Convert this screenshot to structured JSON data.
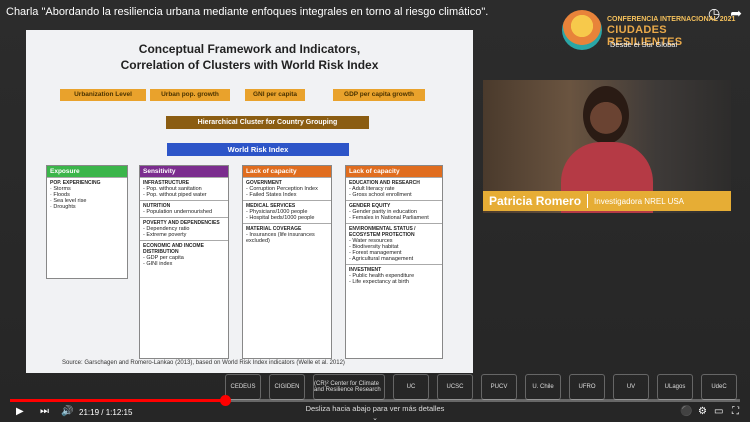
{
  "video": {
    "title": "Charla \"Abordando la resiliencia urbana mediante enfoques integrales en torno al riesgo climático\".",
    "current_time": "21:19",
    "duration": "1:12:15",
    "progress": 0.295,
    "scroll_hint": "Desliza hacia abajo para ver más detalles",
    "scroll_hint_arrow": "⌄"
  },
  "logo": {
    "line1": "CONFERENCIA INTERNACIONAL 2021",
    "line2": "CIUDADES RESILIENTES",
    "line3": "Desde el Sur Global"
  },
  "slide": {
    "heading_line1": "Conceptual Framework and Indicators,",
    "heading_line2": "Correlation of Clusters with World Risk Index",
    "urban_boxes": [
      "Urbanization Level",
      "Urban pop. growth",
      "GNI per capita",
      "GDP per capita growth"
    ],
    "hierarchical": "Hierarchical Cluster for Country Grouping",
    "world_risk": "World Risk Index",
    "columns": [
      {
        "header": "Exposure",
        "color": "#3bb54a",
        "cells": [
          {
            "title": "POP. EXPERIENCING",
            "items": "· Storms\n· Floods\n· Sea level rise\n· Droughts"
          }
        ]
      },
      {
        "header": "Sensitivity",
        "color": "#7b2d8e",
        "cells": [
          {
            "title": "INFRASTRUCTURE",
            "items": "- Pop. without sanitation\n- Pop. without piped water"
          },
          {
            "title": "NUTRITION",
            "items": "- Population undernourished"
          },
          {
            "title": "POVERTY AND DEPENDENCIES",
            "items": "- Dependency ratio\n- Extreme poverty"
          },
          {
            "title": "ECONOMIC AND INCOME DISTRIBUTION",
            "items": "- GDP per capita\n- GINI index"
          }
        ]
      },
      {
        "header": "Lack of capacity",
        "color": "#e06d1f",
        "cells": [
          {
            "title": "GOVERNMENT",
            "items": "- Corruption Perception Index\n- Failed States Index"
          },
          {
            "title": "MEDICAL SERVICES",
            "items": "- Physicians/1000 people\n- Hospital beds/1000 people"
          },
          {
            "title": "MATERIAL COVERAGE",
            "items": "- Insurances (life insurances excluded)"
          }
        ]
      },
      {
        "header": "Lack of capacity",
        "color": "#e06d1f",
        "cells": [
          {
            "title": "EDUCATION AND RESEARCH",
            "items": "- Adult literacy rate\n- Gross school enrollment"
          },
          {
            "title": "GENDER EQUITY",
            "items": "- Gender parity in education\n- Females in National Parliament"
          },
          {
            "title": "ENVIRONMENTAL STATUS / ECOSYSTEM PROTECTION",
            "items": "- Water resources\n- Biodiversity habitat\n- Forest management\n- Agricultural management"
          },
          {
            "title": "INVESTMENT",
            "items": "- Public health expenditure\n- Life expectancy at birth"
          }
        ]
      }
    ],
    "source": "Source: Garschagen and Romero-Lankao (2013), based on World Risk Index indicators (Welle et al. 2012)"
  },
  "speaker": {
    "name": "Patricia Romero",
    "role": "Investigadora NREL USA"
  },
  "sponsors": [
    "CEDEUS",
    "CIGIDEN",
    "(CR)² Center for Climate and Resilience Research",
    "UC",
    "UCSC",
    "PUCV",
    "U. Chile",
    "UFRO",
    "UV",
    "ULagos",
    "UdeC"
  ]
}
